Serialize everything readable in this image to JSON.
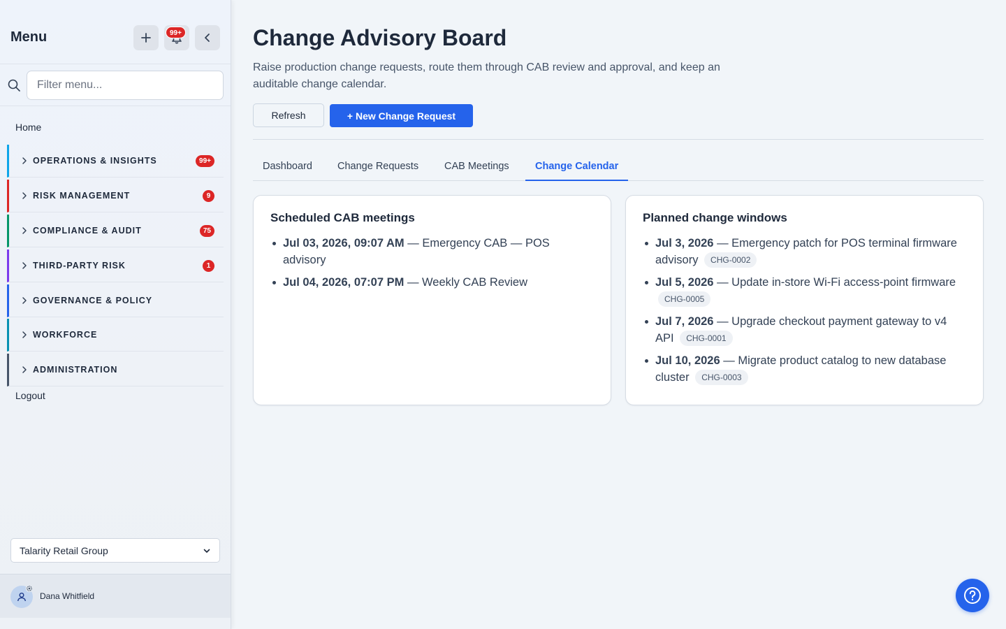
{
  "sidebar": {
    "title": "Menu",
    "notification_badge": "99+",
    "search_placeholder": "Filter menu...",
    "home": "Home",
    "logout": "Logout",
    "groups": [
      {
        "label": "OPERATIONS & INSIGHTS",
        "count": "99+",
        "color": "#0ea5e9"
      },
      {
        "label": "RISK MANAGEMENT",
        "count": "9",
        "color": "#dc2626"
      },
      {
        "label": "COMPLIANCE & AUDIT",
        "count": "75",
        "color": "#059669"
      },
      {
        "label": "THIRD-PARTY RISK",
        "count": "1",
        "color": "#7c3aed"
      },
      {
        "label": "GOVERNANCE & POLICY",
        "count": "",
        "color": "#2563eb"
      },
      {
        "label": "WORKFORCE",
        "count": "",
        "color": "#0891b2"
      },
      {
        "label": "ADMINISTRATION",
        "count": "",
        "color": "#475569"
      }
    ],
    "org": "Talarity Retail Group",
    "user_name": "Dana Whitfield"
  },
  "header": {
    "title": "Change Advisory Board",
    "description": "Raise production change requests, route them through CAB review and approval, and keep an auditable change calendar.",
    "refresh_label": "Refresh",
    "new_label": "+ New Change Request"
  },
  "tabs": [
    {
      "label": "Dashboard",
      "active": false
    },
    {
      "label": "Change Requests",
      "active": false
    },
    {
      "label": "CAB Meetings",
      "active": false
    },
    {
      "label": "Change Calendar",
      "active": true
    }
  ],
  "meetings": {
    "title": "Scheduled CAB meetings",
    "items": [
      {
        "date": "Jul 03, 2026, 09:07 AM",
        "text": " — Emergency CAB — POS advisory"
      },
      {
        "date": "Jul 04, 2026, 07:07 PM",
        "text": " — Weekly CAB Review"
      }
    ]
  },
  "windows": {
    "title": "Planned change windows",
    "items": [
      {
        "date": "Jul 3, 2026",
        "text": " — Emergency patch for POS terminal firmware advisory",
        "id": "CHG-0002"
      },
      {
        "date": "Jul 5, 2026",
        "text": " — Update in-store Wi-Fi access-point firmware",
        "id": "CHG-0005"
      },
      {
        "date": "Jul 7, 2026",
        "text": " — Upgrade checkout payment gateway to v4 API",
        "id": "CHG-0001"
      },
      {
        "date": "Jul 10, 2026",
        "text": " — Migrate product catalog to new database cluster",
        "id": "CHG-0003"
      }
    ]
  },
  "colors": {
    "accent": "#2563eb",
    "badge": "#dc2626"
  },
  "icons": [
    "plus-icon",
    "bell-icon",
    "chevron-left-icon",
    "search-icon",
    "chevron-right-icon",
    "chevron-down-icon",
    "user-icon",
    "gear-icon",
    "help-icon"
  ]
}
